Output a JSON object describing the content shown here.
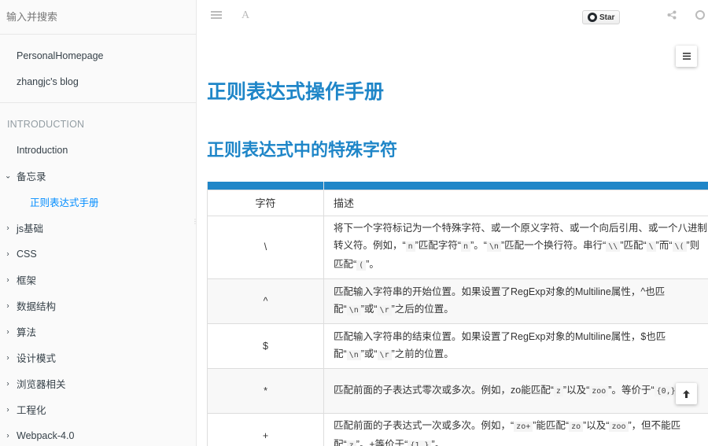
{
  "sidebar": {
    "search_placeholder": "输入并搜索",
    "top_links": [
      "PersonalHomepage",
      "zhangjc's blog"
    ],
    "section_header": "INTRODUCTION",
    "items": [
      {
        "label": "Introduction"
      },
      {
        "label": "备忘录",
        "chevron": "⌄"
      },
      {
        "label": "正则表达式手册"
      },
      {
        "label": "js基础",
        "chevron": "›"
      },
      {
        "label": "CSS",
        "chevron": "›"
      },
      {
        "label": "框架",
        "chevron": "›"
      },
      {
        "label": "数据结构",
        "chevron": "›"
      },
      {
        "label": "算法",
        "chevron": "›"
      },
      {
        "label": "设计模式",
        "chevron": "›"
      },
      {
        "label": "浏览器相关",
        "chevron": "›"
      },
      {
        "label": "工程化",
        "chevron": "›"
      },
      {
        "label": "Webpack-4.0",
        "chevron": "›"
      }
    ]
  },
  "toolbar": {
    "star_label": "Star"
  },
  "content": {
    "title": "正则表达式操作手册",
    "section_title": "正则表达式中的特殊字符",
    "table": {
      "headers": [
        "字符",
        "描述"
      ],
      "rows": [
        {
          "char": "\\",
          "desc": [
            {
              "t": "将下一个字符标记为一个特殊字符、或一个原义字符、或一个向后引用、或一个八进制转义符。例如，“"
            },
            {
              "c": "n"
            },
            {
              "t": "”匹配字符“"
            },
            {
              "c": "n"
            },
            {
              "t": "”。“"
            },
            {
              "c": "\\n"
            },
            {
              "t": "”匹配一个换行符。串行“"
            },
            {
              "c": "\\\\"
            },
            {
              "t": "”匹配“"
            },
            {
              "c": "\\"
            },
            {
              "t": "”而“"
            },
            {
              "c": "\\("
            },
            {
              "t": "”则匹配“"
            },
            {
              "c": "("
            },
            {
              "t": "”。"
            }
          ]
        },
        {
          "char": "^",
          "desc": [
            {
              "t": "匹配输入字符串的开始位置。如果设置了RegExp对象的Multiline属性，^也匹配“"
            },
            {
              "c": "\\n"
            },
            {
              "t": "”或“"
            },
            {
              "c": "\\r"
            },
            {
              "t": "”之后的位置。"
            }
          ]
        },
        {
          "char": "$",
          "desc": [
            {
              "t": "匹配输入字符串的结束位置。如果设置了RegExp对象的Multiline属性，$也匹配“"
            },
            {
              "c": "\\n"
            },
            {
              "t": "”或“"
            },
            {
              "c": "\\r"
            },
            {
              "t": "”之前的位置。"
            }
          ]
        },
        {
          "char": "*",
          "desc": [
            {
              "t": "匹配前面的子表达式零次或多次。例如，zo能匹配“"
            },
            {
              "c": "z"
            },
            {
              "t": "”以及“"
            },
            {
              "c": "zoo"
            },
            {
              "t": "”。等价于“"
            },
            {
              "c": "{0,}"
            },
            {
              "t": "”。"
            }
          ]
        },
        {
          "char": "+",
          "desc": [
            {
              "t": "匹配前面的子表达式一次或多次。例如，“"
            },
            {
              "c": "zo+"
            },
            {
              "t": "”能匹配“"
            },
            {
              "c": "zo"
            },
            {
              "t": "”以及“"
            },
            {
              "c": "zoo"
            },
            {
              "t": "”，但不能匹配“"
            },
            {
              "c": "z"
            },
            {
              "t": "”。+等价于“"
            },
            {
              "c": "{1,}"
            },
            {
              "t": "”。"
            }
          ]
        }
      ]
    }
  }
}
